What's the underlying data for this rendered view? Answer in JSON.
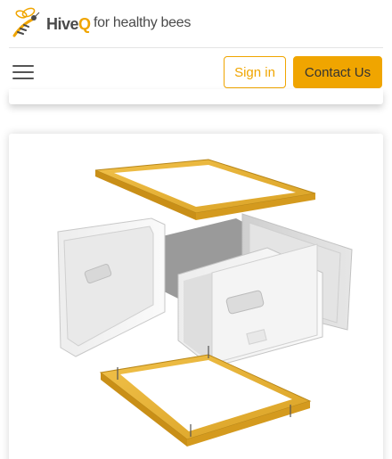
{
  "header": {
    "logo": {
      "brand": "Hive",
      "brand_accent": "Q",
      "tagline": "for healthy bees",
      "icon": "bee-icon"
    },
    "menu_icon": "hamburger-menu-icon"
  },
  "nav": {
    "sign_in_label": "Sign in",
    "contact_label": "Contact Us"
  },
  "colors": {
    "accent": "#f0a500",
    "frame_wood": "#e8b530",
    "hive_body": "#f2f2f2",
    "text_dark": "#4a4a4a"
  },
  "main": {
    "product_image": "hive-exploded-view"
  }
}
